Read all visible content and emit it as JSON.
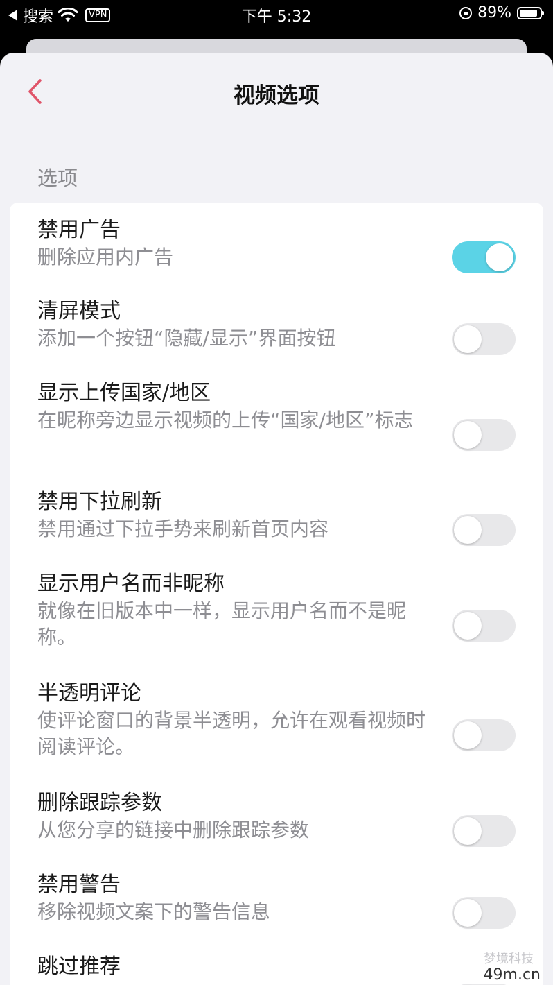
{
  "status_bar": {
    "back_app": "搜索",
    "vpn": "VPN",
    "time": "下午 5:32",
    "battery": "89%",
    "battery_level": 0.89
  },
  "nav": {
    "title": "视频选项"
  },
  "section_label": "选项",
  "options": [
    {
      "title": "禁用广告",
      "desc": "删除应用内广告",
      "enabled": true
    },
    {
      "title": "清屏模式",
      "desc": "添加一个按钮“隐藏/显示”界面按钮",
      "enabled": false
    },
    {
      "title": "显示上传国家/地区",
      "desc": "在昵称旁边显示视频的上传“国家/地区”标志",
      "enabled": false
    },
    {
      "title": "禁用下拉刷新",
      "desc": "禁用通过下拉手势来刷新首页内容",
      "enabled": false
    },
    {
      "title": "显示用户名而非昵称",
      "desc": "就像在旧版本中一样，显示用户名而不是昵称。",
      "enabled": false
    },
    {
      "title": "半透明评论",
      "desc": "使评论窗口的背景半透明，允许在观看视频时阅读评论。",
      "enabled": false
    },
    {
      "title": "删除跟踪参数",
      "desc": "从您分享的链接中删除跟踪参数",
      "enabled": false
    },
    {
      "title": "禁用警告",
      "desc": "移除视频文案下的警告信息",
      "enabled": false
    },
    {
      "title": "跳过推荐",
      "desc": "",
      "enabled": false
    }
  ],
  "watermark": "49m.cn",
  "watermark_faint": "梦境科技",
  "colors": {
    "accent_toggle_on": "#5bd3e6",
    "back_chevron": "#e0556a",
    "toggle_off": "#e8e8ea"
  }
}
